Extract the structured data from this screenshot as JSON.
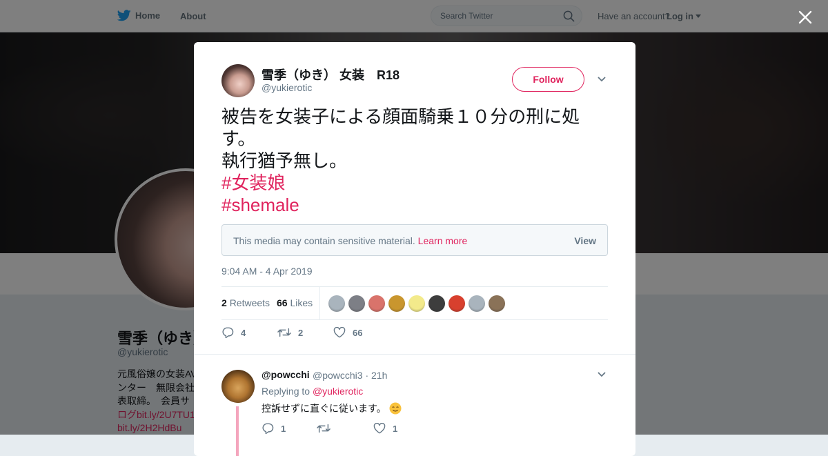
{
  "nav": {
    "home": "Home",
    "about": "About",
    "search_placeholder": "Search Twitter",
    "have_account": "Have an account?",
    "login": "Log in"
  },
  "background_profile": {
    "name": "雪季（ゆき）",
    "handle": "@yukierotic",
    "bio_lines": [
      "元風俗嬢の女装AV",
      "ンター　無限会社",
      "表取締。　会員サ",
      "ログbit.ly/2U7TU1",
      "bit.ly/2H2HdBu"
    ]
  },
  "tweet": {
    "author_name": "雪季（ゆき） 女装　R18",
    "author_handle": "@yukierotic",
    "follow_label": "Follow",
    "text_line1": "被告を女装子による顔面騎乗１０分の刑に処す。",
    "text_line2": "執行猶予無し。",
    "hashtags": [
      "#女装娘",
      "#shemale"
    ],
    "sensitive_message": "This media may contain sensitive material.",
    "learn_more": "Learn more",
    "view_label": "View",
    "timestamp": "9:04 AM - 4 Apr 2019",
    "retweets_count": "2",
    "retweets_label": "Retweets",
    "likes_count": "66",
    "likes_label": "Likes",
    "likers": [
      {
        "color": "#a9b4bd"
      },
      {
        "color": "#7d7f86"
      },
      {
        "color": "#d9736b"
      },
      {
        "color": "#c9962e"
      },
      {
        "color": "#f3ea8b"
      },
      {
        "color": "#3d3d3d"
      },
      {
        "color": "#d8402e"
      },
      {
        "color": "#a9b4bd"
      },
      {
        "color": "#8a7258"
      }
    ],
    "actions": {
      "replies": "4",
      "retweets": "2",
      "likes": "66"
    }
  },
  "reply": {
    "name": "@powcchi",
    "handle_time": "@powcchi3 · 21h",
    "replying_prefix": "Replying to",
    "replying_to": "@yukierotic",
    "text": "控訴せずに直ぐに従います。",
    "actions": {
      "replies": "1",
      "likes": "1"
    }
  },
  "colors": {
    "accent": "#e0245e",
    "twitter_blue": "#1da1f2",
    "muted": "#657786"
  }
}
